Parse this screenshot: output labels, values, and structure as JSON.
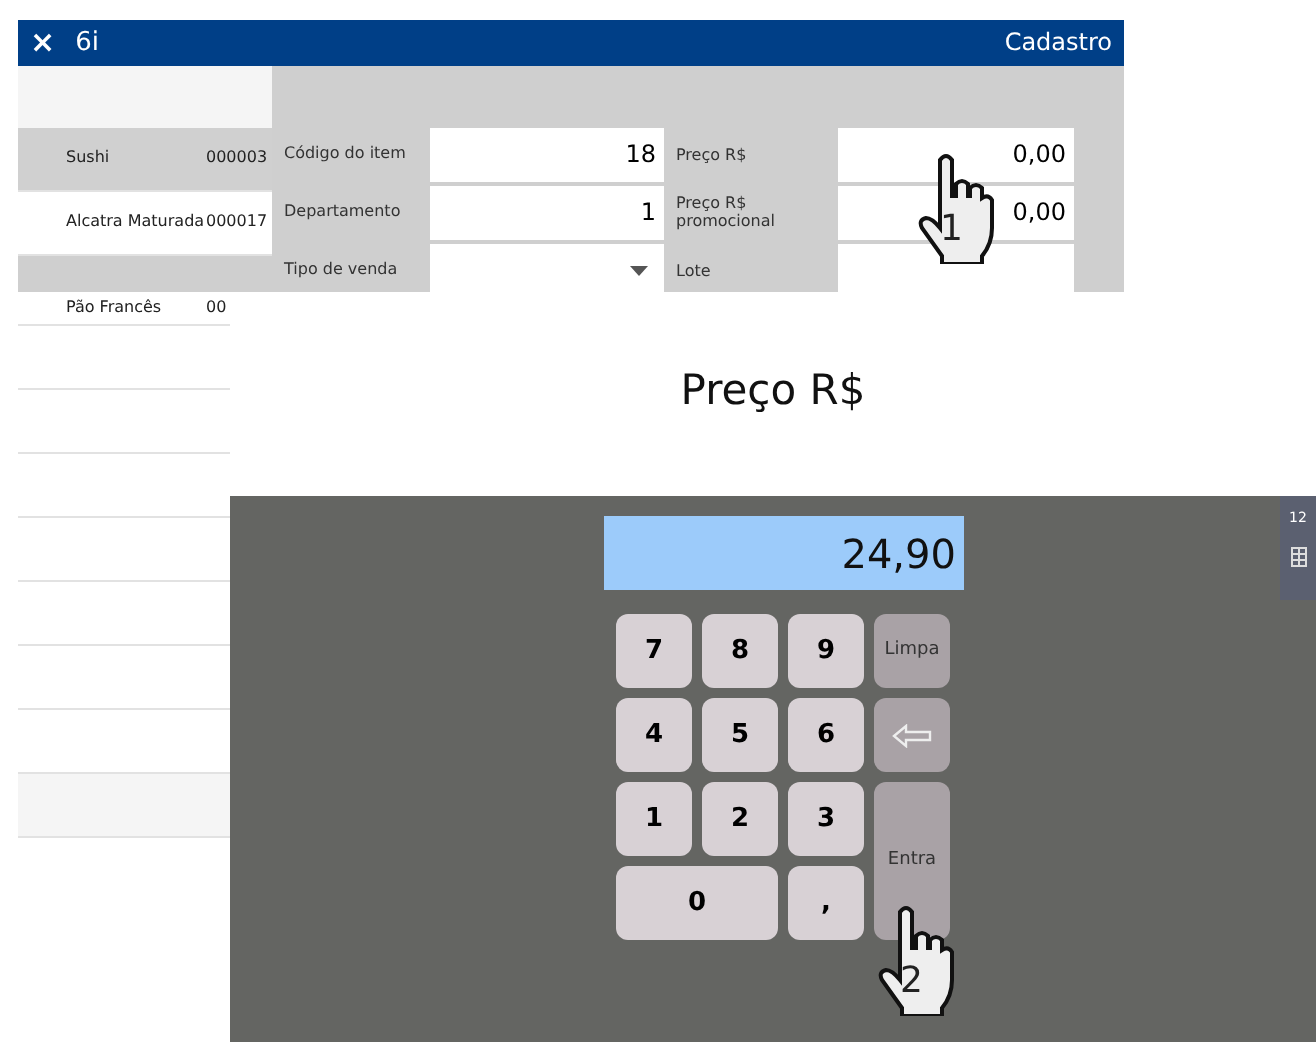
{
  "window": {
    "close_icon": "×",
    "title": "6i",
    "section": "Cadastro"
  },
  "item_list": [
    {
      "name": "Sushi",
      "code": "000003",
      "selected": true
    },
    {
      "name": "Alcatra Maturada",
      "code": "000017",
      "selected": false
    }
  ],
  "item_list_below": [
    {
      "name": "Pão Francês",
      "code": "00",
      "selected": false
    }
  ],
  "form": [
    {
      "label": "Código do item",
      "value": "18",
      "kind": "text"
    },
    {
      "label": "Departamento",
      "value": "1",
      "kind": "text"
    },
    {
      "label": "Tipo de venda",
      "kind": "dropdown"
    }
  ],
  "form_right": [
    {
      "label": "Preço R$",
      "value": "0,00"
    },
    {
      "label": "Preço R$ promocional",
      "value": "0,00"
    },
    {
      "label": "Lote"
    }
  ],
  "callouts": [
    "1",
    "2"
  ],
  "keypad_title": "Preço R$",
  "keypad": {
    "display": "24,90",
    "keys": [
      {
        "label": "7",
        "kind": "digit"
      },
      {
        "label": "8",
        "kind": "digit"
      },
      {
        "label": "9",
        "kind": "digit"
      },
      {
        "label": "Limpa",
        "kind": "action"
      },
      {
        "label": "4",
        "kind": "digit"
      },
      {
        "label": "5",
        "kind": "digit"
      },
      {
        "label": "6",
        "kind": "digit"
      },
      {
        "kind": "backspace"
      },
      {
        "label": "1",
        "kind": "digit"
      },
      {
        "label": "2",
        "kind": "digit"
      },
      {
        "label": "3",
        "kind": "digit"
      },
      {
        "label": "Entra",
        "kind": "enter"
      },
      {
        "label": "0",
        "kind": "zero"
      },
      {
        "label": ",",
        "kind": "digit"
      }
    ]
  },
  "side_tab": {
    "label": "12"
  }
}
